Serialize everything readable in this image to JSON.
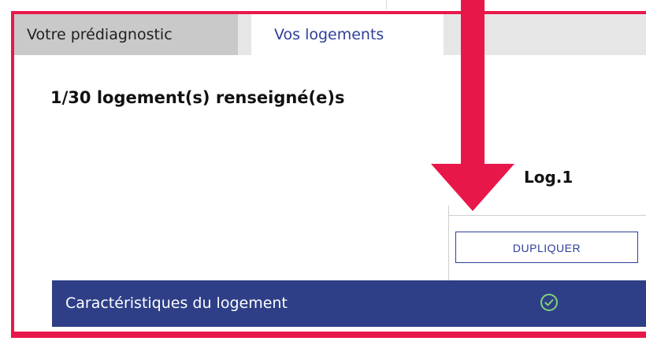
{
  "tabs": [
    {
      "label": "Votre prédiagnostic",
      "active": false
    },
    {
      "label": "Vos logements",
      "active": true
    }
  ],
  "main": {
    "count_title": "1/30 logement(s) renseigné(e)s",
    "column_header": "Log.1",
    "duplicate_label": "DUPLIQUER",
    "section": {
      "label": "Caractéristiques du logement",
      "status_icon": "check-circle-icon",
      "status": "complete"
    }
  },
  "colors": {
    "highlight": "#e8174a",
    "primary": "#2e3f9a",
    "section_band": "#2e3f87",
    "inactive_tab": "#c9c9c9",
    "check": "#7fd37a"
  },
  "annotation": {
    "arrow_icon": "down-arrow-icon"
  }
}
